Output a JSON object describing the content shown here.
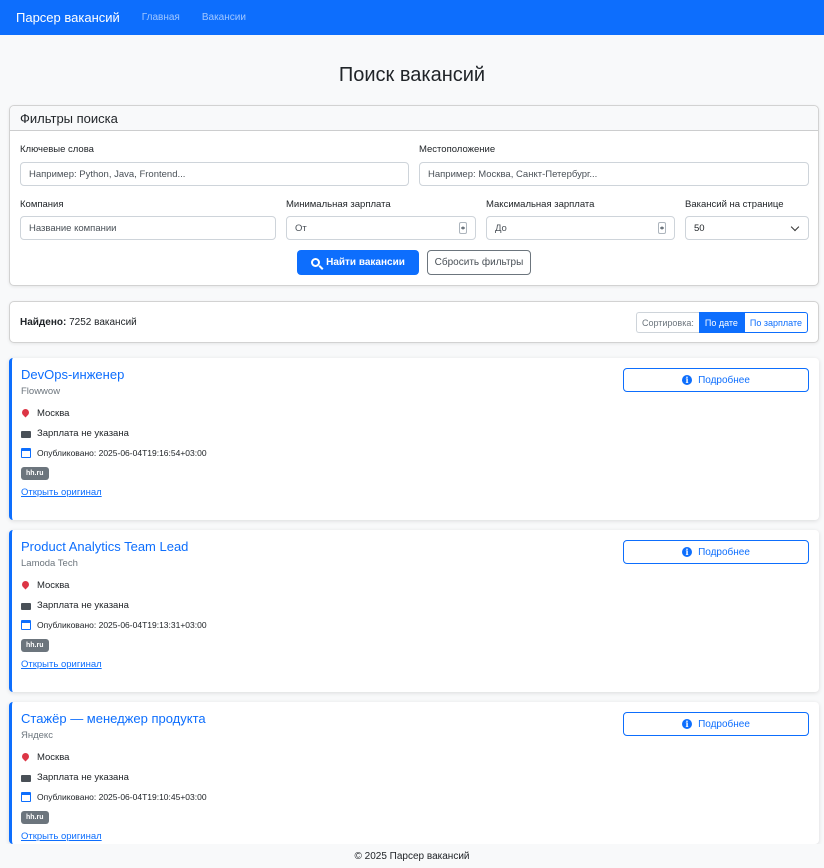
{
  "navbar": {
    "brand": "Парсер вакансий",
    "links": [
      "Главная",
      "Вакансии"
    ]
  },
  "page_title": "Поиск вакансий",
  "filters": {
    "header": "Фильтры поиска",
    "keywords": {
      "label": "Ключевые слова",
      "placeholder": "Например: Python, Java, Frontend..."
    },
    "location": {
      "label": "Местоположение",
      "placeholder": "Например: Москва, Санкт-Петербург..."
    },
    "company": {
      "label": "Компания",
      "placeholder": "Название компании"
    },
    "min_salary": {
      "label": "Минимальная зарплата",
      "placeholder": "От"
    },
    "max_salary": {
      "label": "Максимальная зарплата",
      "placeholder": "До"
    },
    "per_page": {
      "label": "Вакансий на странице",
      "value": "50"
    },
    "search_button": "Найти вакансии",
    "reset_button": "Сбросить фильтры"
  },
  "results": {
    "found_label": "Найдено:",
    "found_text": "7252 вакансий",
    "sort_label": "Сортировка:",
    "sort_date": "По дате",
    "sort_salary": "По зарплате"
  },
  "vacancies": [
    {
      "title": "DevOps-инженер",
      "company": "Flowwow",
      "location": "Москва",
      "salary": "Зарплата не указана",
      "published": "Опубликовано: 2025-06-04T19:16:54+03:00",
      "source": "hh.ru",
      "open_link": "Открыть оригинал",
      "details": "Подробнее"
    },
    {
      "title": "Product Analytics Team Lead",
      "company": "Lamoda Tech",
      "location": "Москва",
      "salary": "Зарплата не указана",
      "published": "Опубликовано: 2025-06-04T19:13:31+03:00",
      "source": "hh.ru",
      "open_link": "Открыть оригинал",
      "details": "Подробнее"
    },
    {
      "title": "Стажёр — менеджер продукта",
      "company": "Яндекс",
      "location": "Москва",
      "salary": "Зарплата не указана",
      "published": "Опубликовано: 2025-06-04T19:10:45+03:00",
      "source": "hh.ru",
      "open_link": "Открыть оригинал",
      "details": "Подробнее"
    }
  ],
  "footer": "© 2025 Парсер вакансий",
  "colors": {
    "primary": "#0d6efd",
    "secondary": "#6c757d",
    "danger": "#dc3545"
  }
}
